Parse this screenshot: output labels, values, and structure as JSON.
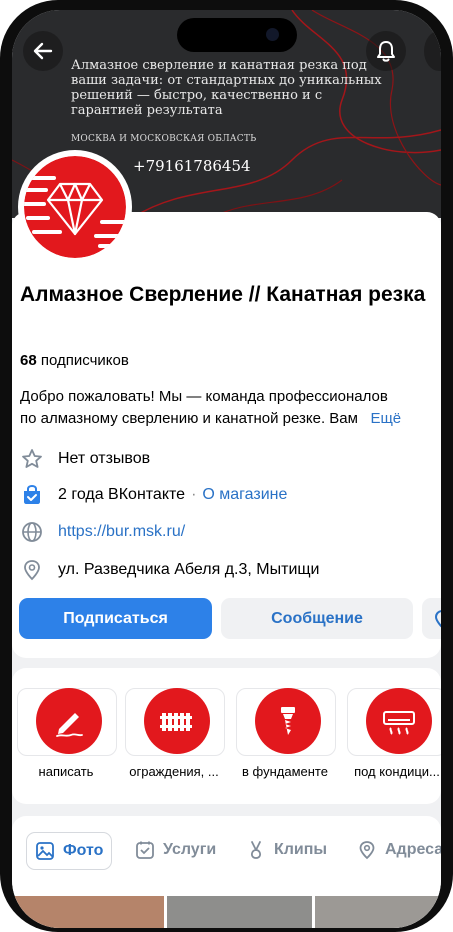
{
  "colors": {
    "accent": "#2d81e8",
    "link": "#2a72c6",
    "brand_red": "#e2181d"
  },
  "cover": {
    "tagline": "Алмазное сверление и канатная резка под ваши задачи: от стандартных до уникальных решений — быстро, качественно и с гарантией результата",
    "region": "МОСКВА И МОСКОВСКАЯ ОБЛАСТЬ",
    "phone": "+79161786454"
  },
  "header": {
    "back_icon": "arrow-left-icon",
    "bell_icon": "bell-icon"
  },
  "profile": {
    "title": "Алмазное Сверление // Канатная резка",
    "subscribers_count": "68",
    "subscribers_label": "подписчиков",
    "description_line1": "Добро пожаловать! Мы — команда профессионалов",
    "description_line2": "по алмазному сверлению и канатной резке. Вам",
    "description_more": "Ещё"
  },
  "info": {
    "reviews": "Нет отзывов",
    "age": "2 года ВКонтакте",
    "shop_link": "О магазине",
    "site": "https://bur.msk.ru/",
    "address": "ул. Разведчика Абеля д.3, Мытищи"
  },
  "actions": {
    "subscribe": "Подписаться",
    "message": "Сообщение"
  },
  "categories": [
    {
      "label": "написать",
      "icon": "pen-icon"
    },
    {
      "label": "ограждения, ...",
      "icon": "fence-icon"
    },
    {
      "label": "в фундаменте",
      "icon": "drill-icon"
    },
    {
      "label": "под кондици...",
      "icon": "air-conditioner-icon"
    }
  ],
  "tabs": [
    {
      "label": "Фото",
      "icon": "photo-icon",
      "active": true
    },
    {
      "label": "Услуги",
      "icon": "services-icon"
    },
    {
      "label": "Клипы",
      "icon": "clips-icon"
    },
    {
      "label": "Адреса",
      "icon": "location-icon"
    }
  ]
}
